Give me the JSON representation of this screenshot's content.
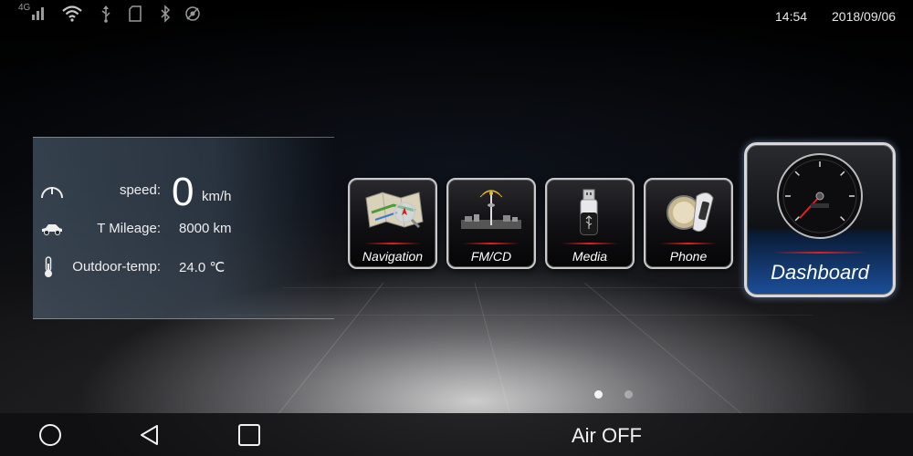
{
  "status_bar": {
    "network_label": "4G",
    "icons": [
      "signal-icon",
      "wifi-icon",
      "usb-icon",
      "sd-card-icon",
      "bluetooth-icon",
      "no-gps-icon"
    ],
    "time": "14:54",
    "date": "2018/09/06"
  },
  "info_panel": {
    "speed_label": "speed:",
    "speed_value": "0",
    "speed_unit": "km/h",
    "mileage_label": "T Mileage:",
    "mileage_value": "8000 km",
    "temp_label": "Outdoor-temp:",
    "temp_value": "24.0 ℃"
  },
  "apps": [
    {
      "label": "Navigation",
      "icon": "map-icon"
    },
    {
      "label": "FM/CD",
      "icon": "radio-tower-icon"
    },
    {
      "label": "Media",
      "icon": "usb-drive-icon"
    },
    {
      "label": "Phone",
      "icon": "phone-icon"
    }
  ],
  "featured_app": {
    "label": "Dashboard",
    "icon": "speedometer-icon"
  },
  "pager": {
    "pages": 2,
    "current": 1
  },
  "nav_bar": {
    "home_icon": "home-circle-icon",
    "back_icon": "back-triangle-icon",
    "recents_icon": "recents-square-icon",
    "air_status": "Air OFF"
  },
  "colors": {
    "accent_red": "#e02020",
    "dashboard_blue": "#1b4f9a",
    "panel_tint": "#5a6e82"
  }
}
